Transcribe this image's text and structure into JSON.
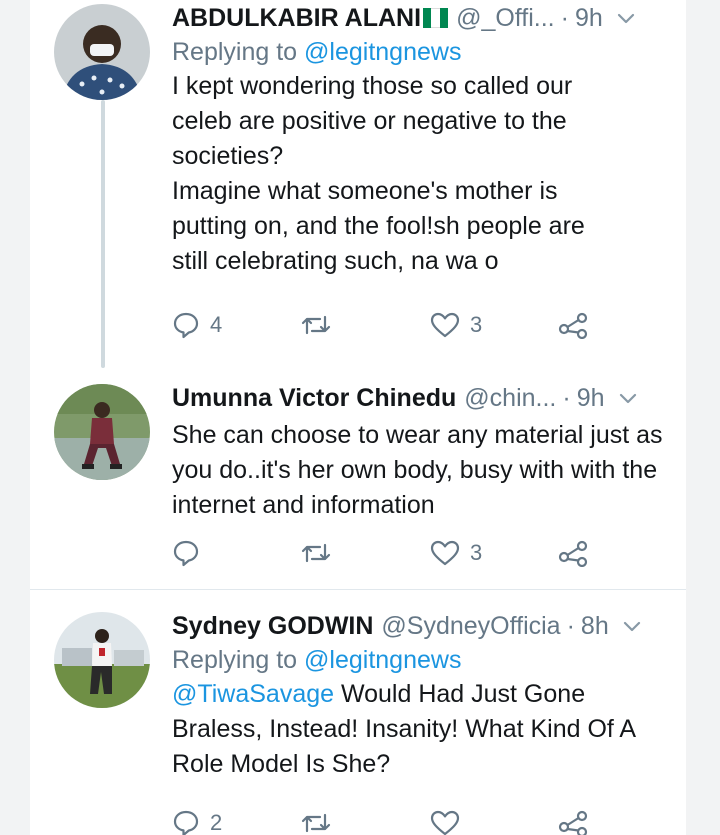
{
  "tweets": [
    {
      "name": "ABDULKABIR ALANI",
      "handle": "@_Offi...",
      "time": "9h",
      "reply_prefix": "Replying to",
      "reply_to": "@legitngnews",
      "text": "I kept wondering those so called our celeb are positive or negative to the societies?\nImagine what someone's mother is putting on, and the fool!sh people are still celebrating such, na wa o",
      "replies": "4",
      "retweets": "",
      "likes": "3"
    },
    {
      "name": "Umunna Victor Chinedu",
      "handle": "@chin...",
      "time": "9h",
      "text": "She can choose to wear any material just as you do..it's her own body, busy with with the internet and information",
      "replies": "",
      "retweets": "",
      "likes": "3"
    },
    {
      "name": "Sydney GODWIN",
      "handle": "@SydneyOfficia",
      "time": "8h",
      "reply_prefix": "Replying to",
      "reply_to": "@legitngnews",
      "mention": "@TiwaSavage",
      "text": " Would Had Just Gone Braless, Instead! Insanity! What Kind Of A Role Model Is She?",
      "replies": "2",
      "retweets": "",
      "likes": ""
    }
  ],
  "icons": {
    "reply": "speech-bubble",
    "retweet": "retweet-arrows",
    "like": "heart-outline",
    "share": "share-nodes",
    "more": "chevron-down"
  },
  "colors": {
    "text": "#14171a",
    "secondary": "#657786",
    "link": "#1b95e0",
    "nigeria_green": "#008751"
  }
}
